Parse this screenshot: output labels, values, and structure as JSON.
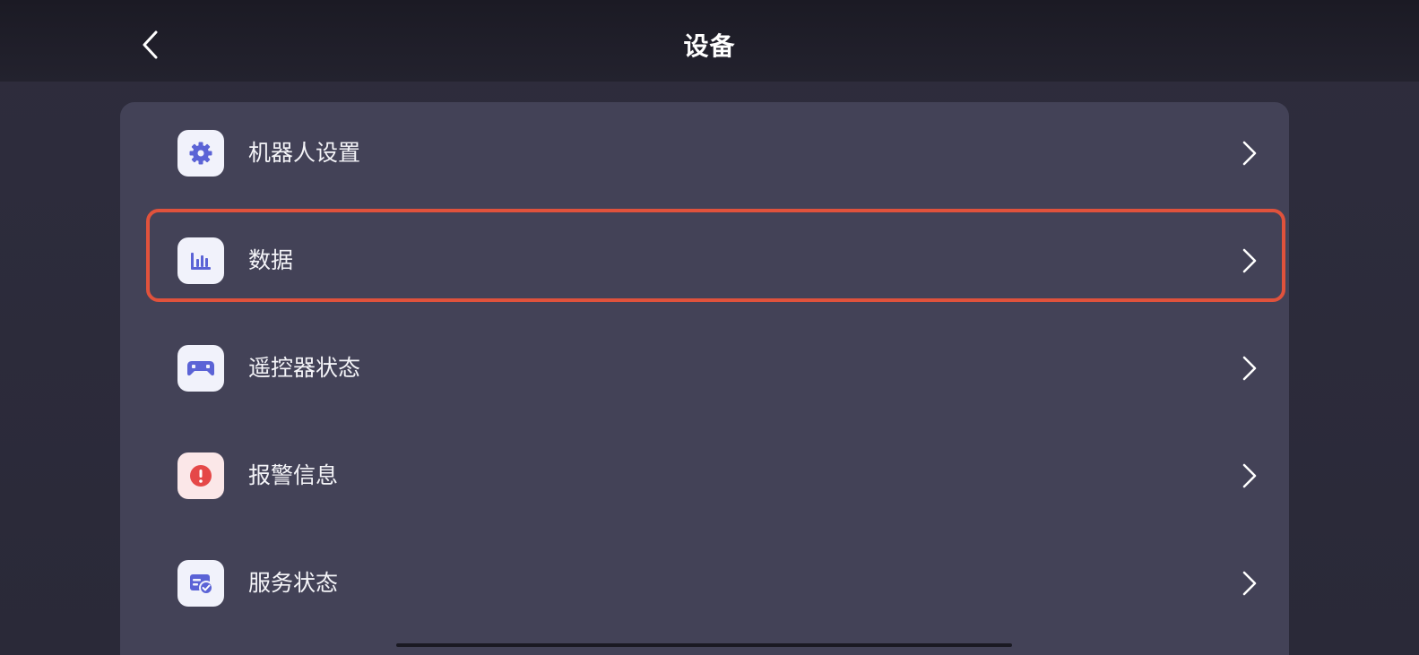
{
  "header": {
    "title": "设备",
    "back_icon": "chevron-left-icon"
  },
  "menu": {
    "items": [
      {
        "label": "机器人设置",
        "icon": "gear-icon",
        "icon_color": "#5b63d6"
      },
      {
        "label": "数据",
        "icon": "bar-chart-icon",
        "icon_color": "#5b63d6"
      },
      {
        "label": "遥控器状态",
        "icon": "gamepad-icon",
        "icon_color": "#5b63d6"
      },
      {
        "label": "报警信息",
        "icon": "alert-icon",
        "icon_color": "#e54848"
      },
      {
        "label": "服务状态",
        "icon": "service-check-icon",
        "icon_color": "#5b63d6"
      }
    ],
    "highlighted_item": "数据",
    "highlight_color": "#e0523c"
  }
}
